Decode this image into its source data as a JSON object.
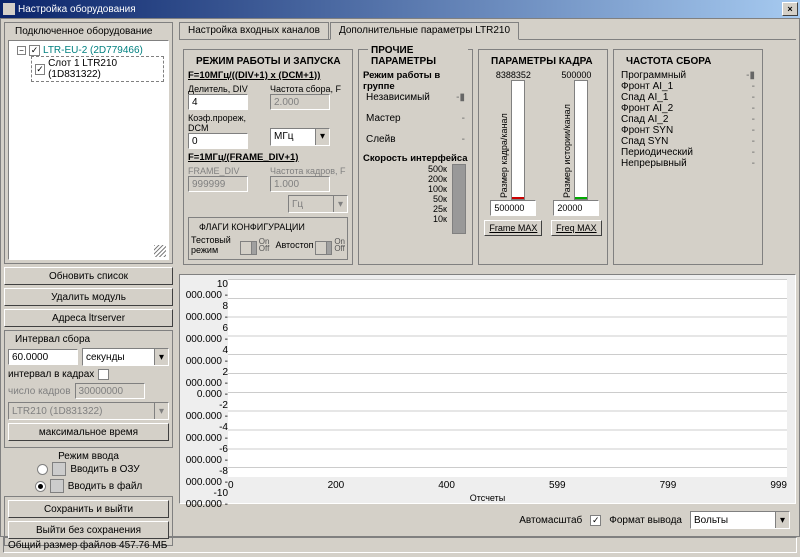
{
  "window": {
    "title": "Настройка оборудования"
  },
  "tree": {
    "header": "Подключенное оборудование",
    "root": "LTR-EU-2 (2D779466)",
    "child": "Слот 1 LTR210 (1D831322)"
  },
  "left_buttons": {
    "refresh": "Обновить список",
    "delete": "Удалить модуль",
    "addr": "Адреса ltrserver"
  },
  "interval_grp": {
    "title": "Интервал сбора",
    "value": "60.0000",
    "unit": "секунды",
    "in_frames_lbl": "интервал в кадрах",
    "nframes_lbl": "число кадров",
    "nframes_val": "30000000",
    "module_sel": "LTR210 (1D831322)",
    "max_time": "максимальное время"
  },
  "input_mode": {
    "title": "Режим ввода",
    "ram": "Вводить в ОЗУ",
    "file": "Вводить в файл"
  },
  "save_buttons": {
    "save": "Сохранить и выйти",
    "cancel": "Выйти без сохранения"
  },
  "tabs": {
    "inputs": "Настройка входных каналов",
    "extra": "Дополнительные параметры LTR210"
  },
  "mode_grp": {
    "title": "РЕЖИМ РАБОТЫ И ЗАПУСКА",
    "formula1": "F=10МГц/((DIV+1) x (DCM+1))",
    "div_lbl": "Делитель, DIV",
    "div_val": "4",
    "freq_lbl": "Частота сбора, F",
    "freq_val": "2.000",
    "dcm_lbl": "Коэф.прореж, DCM",
    "dcm_val": "0",
    "unit_sel": "МГц",
    "formula2": "F=1МГц/(FRAME_DIV+1)",
    "fdiv_lbl": "FRAME_DIV",
    "fdiv_val": "999999",
    "frate_lbl": "Частота кадров, F",
    "frate_val": "1.000",
    "funit": "Гц",
    "flags_title": "ФЛАГИ КОНФИГУРАЦИИ",
    "test_mode": "Тестовый режим",
    "autostop": "Автостоп"
  },
  "other_grp": {
    "title": "ПРОЧИЕ ПАРАМЕТРЫ",
    "group_mode_lbl": "Режим работы в группе",
    "indep": "Независимый",
    "master": "Мастер",
    "slave": "Слейв",
    "iface_lbl": "Скорость интерфейса",
    "scale": [
      "500к",
      "200к",
      "100к",
      "50к",
      "25к",
      "10к"
    ]
  },
  "frame_grp": {
    "title": "ПАРАМЕТРЫ КАДРА",
    "left_top": "8388352",
    "right_top": "500000",
    "left_side": "Размер кадра/канал",
    "right_side": "Размер истории/канал",
    "left_val": "500000",
    "right_val": "20000",
    "left_btn": "Frame MAX",
    "right_btn": "Freq MAX"
  },
  "freq_grp": {
    "title": "ЧАСТОТА СБОРА",
    "rows": [
      "Программный",
      "Фронт AI_1",
      "Спад AI_1",
      "Фронт AI_2",
      "Спад AI_2",
      "Фронт SYN",
      "Спад SYN",
      "Периодический",
      "Непрерывный"
    ]
  },
  "chart_data": {
    "type": "line",
    "title": "",
    "xlabel": "Отсчеты",
    "ylabel": "",
    "ylim": [
      -10000,
      10000
    ],
    "xlim": [
      0,
      999
    ],
    "yticks": [
      10000,
      8000,
      6000,
      4000,
      2000,
      0,
      -2000,
      -4000,
      -6000,
      -8000,
      -10000
    ],
    "xticks": [
      0,
      200,
      400,
      599,
      799,
      999
    ],
    "series": []
  },
  "bottom": {
    "autoscale": "Автомасштаб",
    "format_lbl": "Формат вывода",
    "format_val": "Вольты"
  },
  "status": {
    "text": "Общий размер файлов 457.76 МБ"
  },
  "glyph": {
    "down": "▾",
    "check": "✓",
    "minus": "−"
  }
}
